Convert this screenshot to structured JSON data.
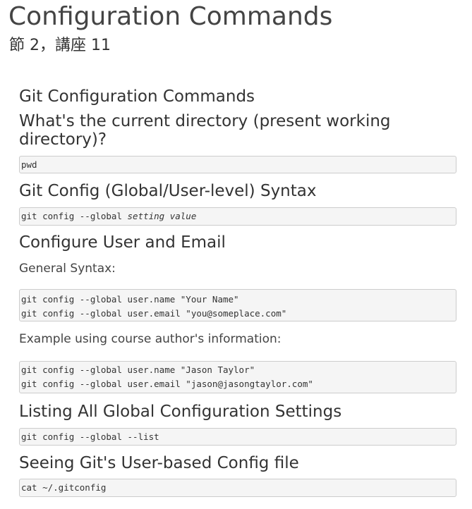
{
  "header": {
    "title": "Configuration Commands",
    "subtitle": "節 2，講座 11"
  },
  "lecture": {
    "section_title": "Git Configuration Commands",
    "pwd_heading": "What's the current directory (present working directory)?",
    "pwd_code": "pwd",
    "syntax_heading": "Git Config (Global/User-level) Syntax",
    "syntax_code_prefix": "git config --global ",
    "syntax_code_args": "setting value",
    "user_heading": "Configure User and Email",
    "general_syntax_label": "General Syntax:",
    "general_code": [
      "git config --global user.name \"Your Name\"",
      "git config --global user.email \"you@someplace.com\""
    ],
    "example_label": "Example using course author's information:",
    "example_code": [
      "git config --global user.name \"Jason Taylor\"",
      "git config --global user.email \"jason@jasongtaylor.com\""
    ],
    "listing_heading": "Listing All Global Configuration Settings",
    "listing_code": "git config --global --list",
    "config_file_heading": "Seeing Git's User-based Config file",
    "config_file_code": "cat ~/.gitconfig"
  }
}
